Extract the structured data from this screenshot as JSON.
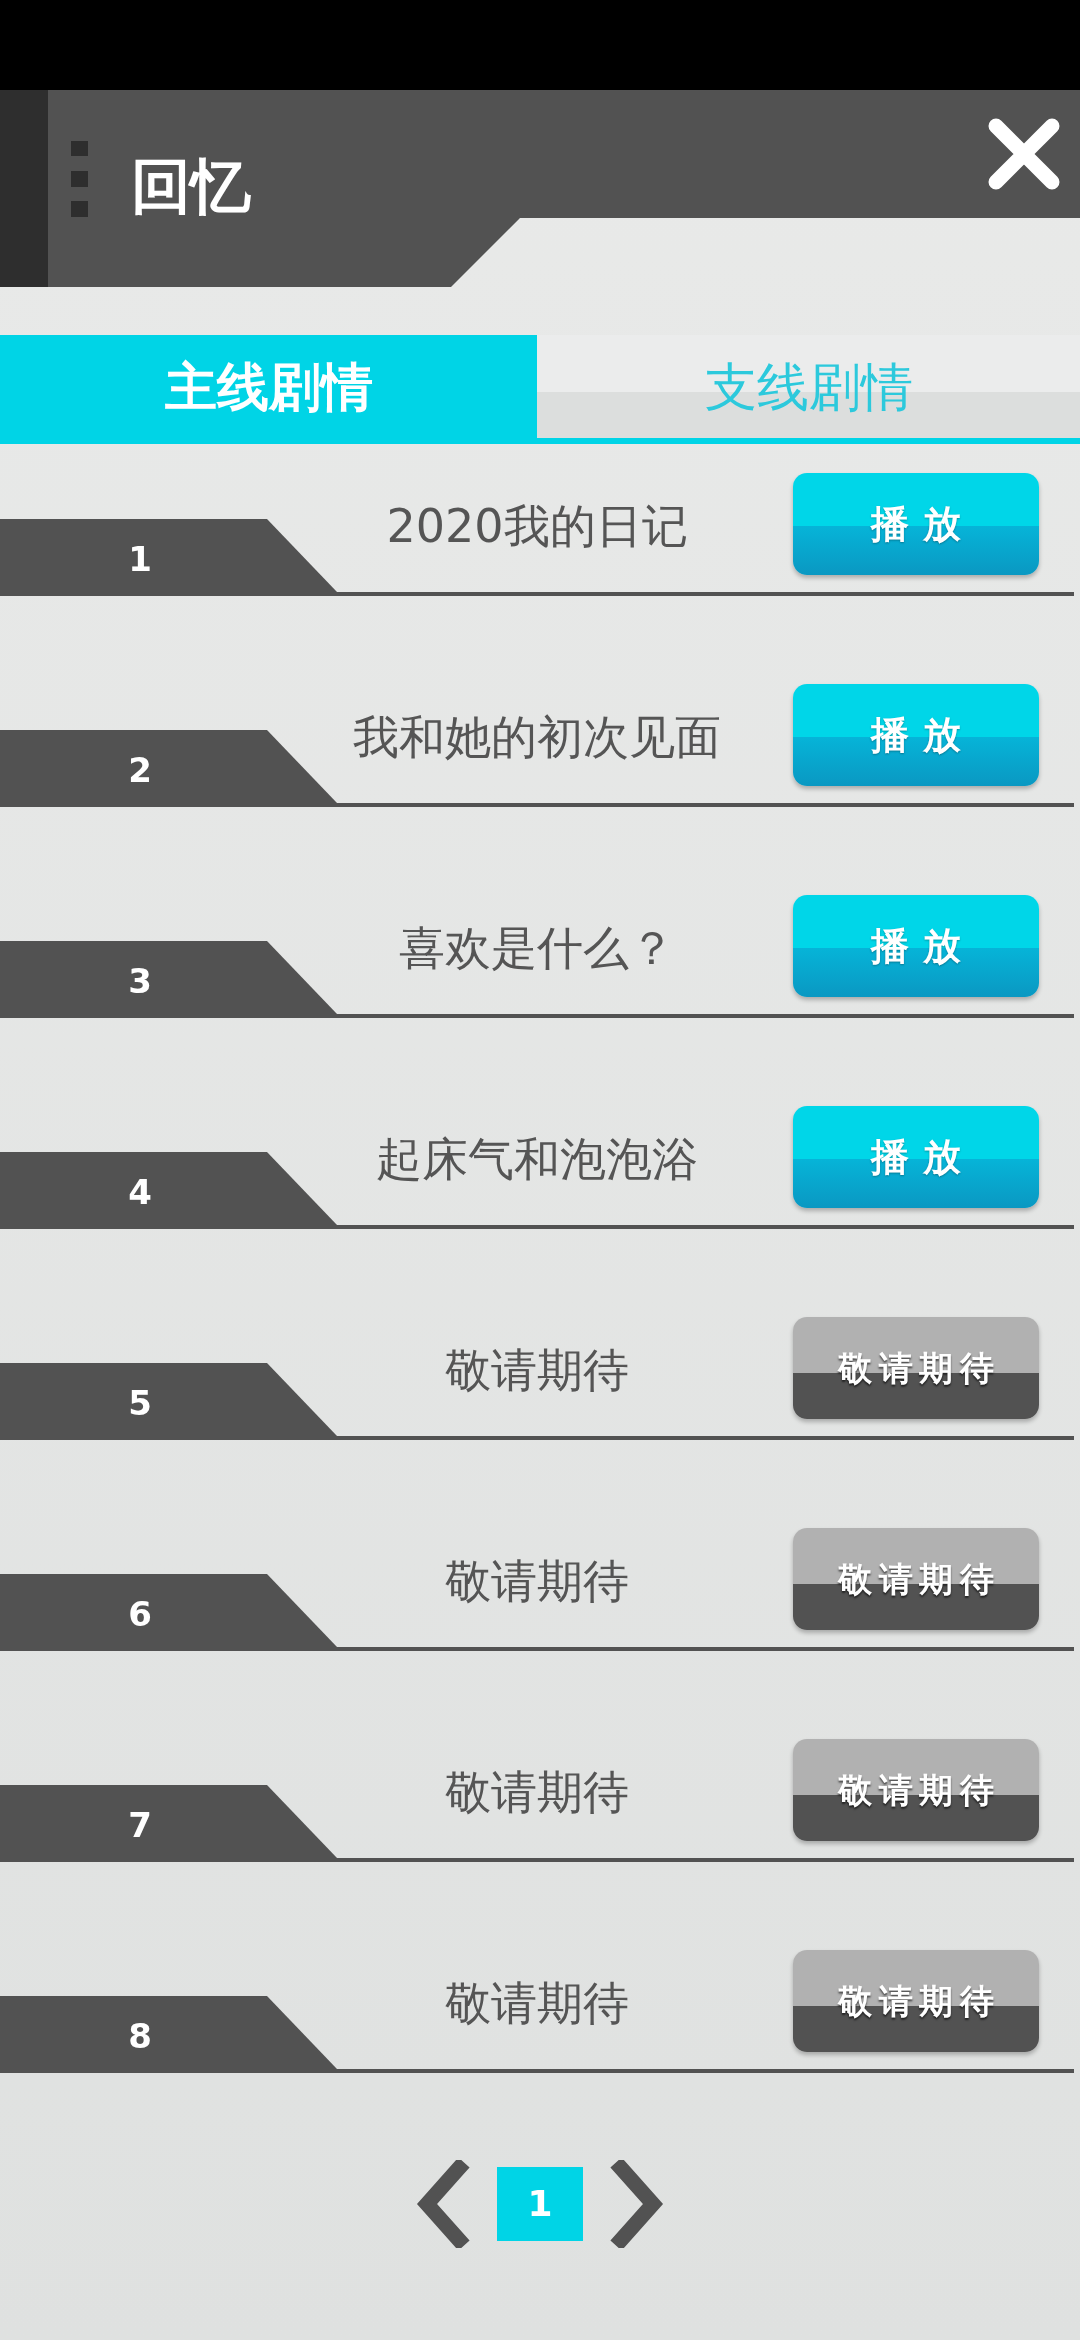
{
  "header": {
    "title": "回忆"
  },
  "tabs": [
    {
      "label": "主线剧情",
      "selected": true
    },
    {
      "label": "支线剧情",
      "selected": false
    }
  ],
  "chapters": [
    {
      "number": "1",
      "title": "2020我的日记",
      "button": "播放",
      "disabled": false
    },
    {
      "number": "2",
      "title": "我和她的初次见面",
      "button": "播放",
      "disabled": false
    },
    {
      "number": "3",
      "title": "喜欢是什么？",
      "button": "播放",
      "disabled": false
    },
    {
      "number": "4",
      "title": "起床气和泡泡浴",
      "button": "播放",
      "disabled": false
    },
    {
      "number": "5",
      "title": "敬请期待",
      "button": "敬请期待",
      "disabled": true
    },
    {
      "number": "6",
      "title": "敬请期待",
      "button": "敬请期待",
      "disabled": true
    },
    {
      "number": "7",
      "title": "敬请期待",
      "button": "敬请期待",
      "disabled": true
    },
    {
      "number": "8",
      "title": "敬请期待",
      "button": "敬请期待",
      "disabled": true
    }
  ],
  "pagination": {
    "page": "1"
  }
}
